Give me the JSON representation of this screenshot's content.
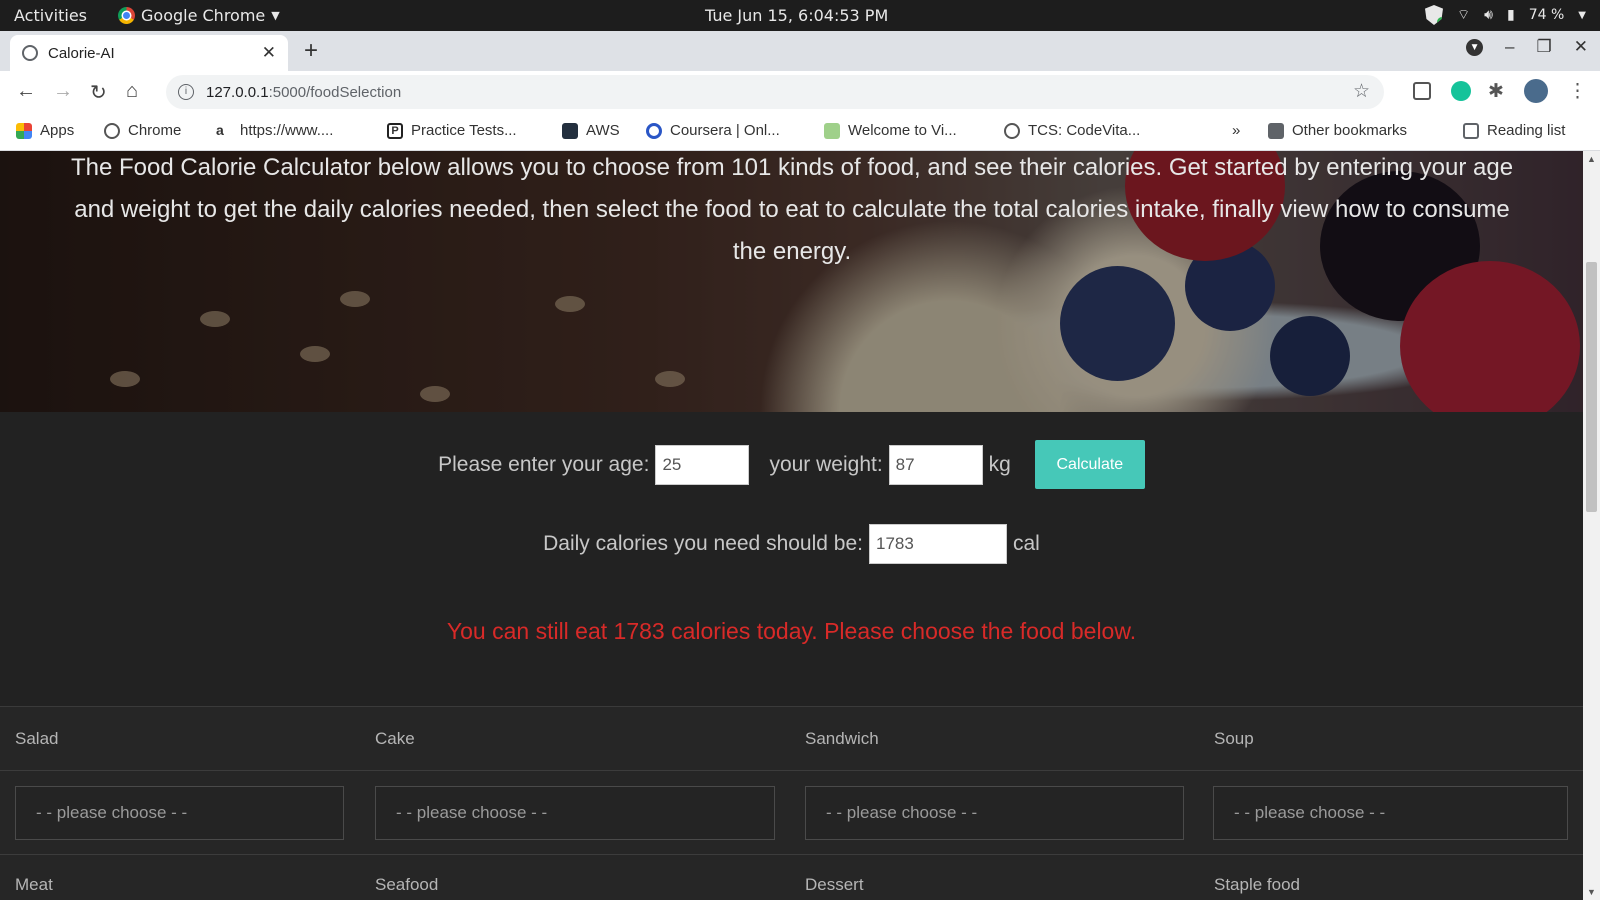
{
  "system_bar": {
    "activities": "Activities",
    "app_name": "Google Chrome",
    "datetime": "Tue Jun 15,  6:04:53 PM",
    "battery": "74 %"
  },
  "browser": {
    "tab_title": "Calorie-AI",
    "url_host": "127.0.0.1",
    "url_path": ":5000/foodSelection",
    "bookmarks": [
      {
        "label": "Apps",
        "icon": "apps-grid-icon"
      },
      {
        "label": "Chrome",
        "icon": "globe-icon"
      },
      {
        "label": "https://www....",
        "icon": "amazon-icon"
      },
      {
        "label": "Practice Tests...",
        "icon": "p-icon"
      },
      {
        "label": "AWS",
        "icon": "aws-icon"
      },
      {
        "label": "Coursera | Onl...",
        "icon": "coursera-icon"
      },
      {
        "label": "Welcome to Vi...",
        "icon": "vi-icon"
      },
      {
        "label": "TCS: CodeVita...",
        "icon": "globe-icon"
      }
    ],
    "more_bookmarks": "»",
    "other_bookmarks": "Other bookmarks",
    "reading_list": "Reading list"
  },
  "page": {
    "intro": "The Food Calorie Calculator below allows you to choose from 101 kinds of food, and see their calories. Get started by entering your age and weight to get the daily calories needed, then select the food to eat to calculate the total calories intake, finally view how to consume the energy.",
    "age_label": "Please enter your age:",
    "age_value": "25",
    "weight_label": "your weight:",
    "weight_value": "87",
    "weight_unit": "kg",
    "calculate_label": "Calculate",
    "daily_label": "Daily calories you need should be:",
    "daily_value": "1783",
    "daily_unit": "cal",
    "remaining_message": "You can still eat 1783 calories today. Please choose the food below.",
    "categories": [
      "Salad",
      "Cake",
      "Sandwich",
      "Soup"
    ],
    "select_placeholder": "- - please choose - -",
    "categories_row2": [
      "Meat",
      "Seafood",
      "Dessert",
      "Staple food"
    ]
  },
  "colors": {
    "accent": "#46c8b8",
    "warning": "#d82a28",
    "page_bg": "#222222"
  }
}
